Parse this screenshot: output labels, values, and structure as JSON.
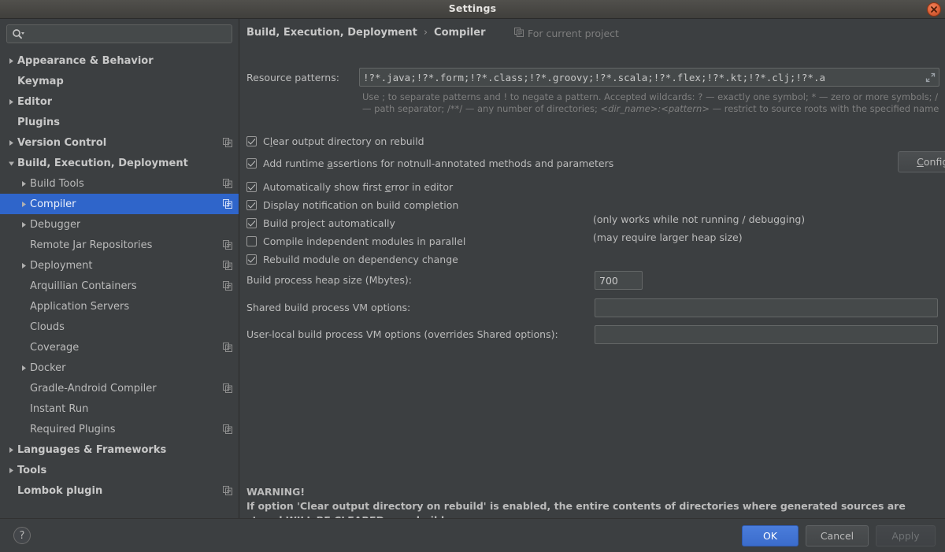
{
  "window": {
    "title": "Settings",
    "close_icon": "close-icon"
  },
  "sidebar": {
    "search": {
      "placeholder": "",
      "value": "",
      "icon": "search-icon"
    },
    "items": [
      {
        "label": "Appearance & Behavior",
        "level": 0,
        "twisty": "collapsed",
        "bold": true,
        "project_icon": false,
        "selected": false
      },
      {
        "label": "Keymap",
        "level": 0,
        "twisty": "none",
        "bold": true,
        "project_icon": false,
        "selected": false
      },
      {
        "label": "Editor",
        "level": 0,
        "twisty": "collapsed",
        "bold": true,
        "project_icon": false,
        "selected": false
      },
      {
        "label": "Plugins",
        "level": 0,
        "twisty": "none",
        "bold": true,
        "project_icon": false,
        "selected": false
      },
      {
        "label": "Version Control",
        "level": 0,
        "twisty": "collapsed",
        "bold": true,
        "project_icon": true,
        "selected": false
      },
      {
        "label": "Build, Execution, Deployment",
        "level": 0,
        "twisty": "expanded",
        "bold": true,
        "project_icon": false,
        "selected": false
      },
      {
        "label": "Build Tools",
        "level": 1,
        "twisty": "collapsed",
        "bold": false,
        "project_icon": true,
        "selected": false
      },
      {
        "label": "Compiler",
        "level": 1,
        "twisty": "collapsed",
        "bold": false,
        "project_icon": true,
        "selected": true
      },
      {
        "label": "Debugger",
        "level": 1,
        "twisty": "collapsed",
        "bold": false,
        "project_icon": false,
        "selected": false
      },
      {
        "label": "Remote Jar Repositories",
        "level": 1,
        "twisty": "none",
        "bold": false,
        "project_icon": true,
        "selected": false
      },
      {
        "label": "Deployment",
        "level": 1,
        "twisty": "collapsed",
        "bold": false,
        "project_icon": true,
        "selected": false
      },
      {
        "label": "Arquillian Containers",
        "level": 1,
        "twisty": "none",
        "bold": false,
        "project_icon": true,
        "selected": false
      },
      {
        "label": "Application Servers",
        "level": 1,
        "twisty": "none",
        "bold": false,
        "project_icon": false,
        "selected": false
      },
      {
        "label": "Clouds",
        "level": 1,
        "twisty": "none",
        "bold": false,
        "project_icon": false,
        "selected": false
      },
      {
        "label": "Coverage",
        "level": 1,
        "twisty": "none",
        "bold": false,
        "project_icon": true,
        "selected": false
      },
      {
        "label": "Docker",
        "level": 1,
        "twisty": "collapsed",
        "bold": false,
        "project_icon": false,
        "selected": false
      },
      {
        "label": "Gradle-Android Compiler",
        "level": 1,
        "twisty": "none",
        "bold": false,
        "project_icon": true,
        "selected": false
      },
      {
        "label": "Instant Run",
        "level": 1,
        "twisty": "none",
        "bold": false,
        "project_icon": false,
        "selected": false
      },
      {
        "label": "Required Plugins",
        "level": 1,
        "twisty": "none",
        "bold": false,
        "project_icon": true,
        "selected": false
      },
      {
        "label": "Languages & Frameworks",
        "level": 0,
        "twisty": "collapsed",
        "bold": true,
        "project_icon": false,
        "selected": false
      },
      {
        "label": "Tools",
        "level": 0,
        "twisty": "collapsed",
        "bold": true,
        "project_icon": false,
        "selected": false
      },
      {
        "label": "Lombok plugin",
        "level": 0,
        "twisty": "none",
        "bold": true,
        "project_icon": true,
        "selected": false
      }
    ]
  },
  "main": {
    "breadcrumb": {
      "root": "Build, Execution, Deployment",
      "separator": "›",
      "current": "Compiler"
    },
    "project_badge": {
      "label": "For current project",
      "icon": "copy-settings-icon"
    },
    "resource_patterns": {
      "label": "Resource patterns:",
      "value": "!?*.java;!?*.form;!?*.class;!?*.groovy;!?*.scala;!?*.flex;!?*.kt;!?*.clj;!?*.a",
      "expand_icon": "expand-icon"
    },
    "hint": {
      "part1": "Use ; to separate patterns and ! to negate a pattern. Accepted wildcards: ? — exactly one symbol; * — zero or more symbols; / — path separator; /**/ — any number of directories; ",
      "italic": "<dir_name>:<pattern>",
      "part2": " — restrict to source roots with the specified name"
    },
    "checkboxes": [
      {
        "label_pre": "C",
        "mnemonic": "l",
        "label_post": "ear output directory on rebuild",
        "checked": true
      },
      {
        "label_pre": "Add runtime ",
        "mnemonic": "a",
        "label_post": "ssertions for notnull-annotated methods and parameters",
        "checked": true
      },
      {
        "label_pre": "Automatically show first ",
        "mnemonic": "e",
        "label_post": "rror in editor",
        "checked": true
      },
      {
        "label_pre": "Display notification on build completion",
        "mnemonic": "",
        "label_post": "",
        "checked": true
      },
      {
        "label_pre": "Build project automatically",
        "mnemonic": "",
        "label_post": "",
        "checked": true
      },
      {
        "label_pre": "Compile independent modules in parallel",
        "mnemonic": "",
        "label_post": "",
        "checked": false
      },
      {
        "label_pre": "Rebuild module on dependency change",
        "mnemonic": "",
        "label_post": "",
        "checked": true
      }
    ],
    "notes": {
      "build_auto": "(only works while not running / debugging)",
      "parallel": "(may require larger heap size)"
    },
    "configure_annotations": {
      "pre": "C",
      "mnemonic_char": "C",
      "label": "Configure annotations..."
    },
    "heap": {
      "label": "Build process heap size (Mbytes):",
      "value": "700"
    },
    "shared_vm": {
      "label": "Shared build process VM options:",
      "value": "",
      "placeholder": ""
    },
    "userlocal_vm": {
      "label": "User-local build process VM options (overrides Shared options):",
      "value": "",
      "placeholder": ""
    },
    "warning": {
      "title": "WARNING!",
      "body": "If option 'Clear output directory on rebuild' is enabled, the entire contents of directories where generated sources are stored WILL BE CLEARED on rebuild."
    }
  },
  "footer": {
    "help_label": "?",
    "ok": "OK",
    "cancel": "Cancel",
    "apply": "Apply"
  },
  "colors": {
    "background": "#3c3f41",
    "selection": "#2f65ca",
    "accent_ok": "#3b6ccc",
    "text": "#bbbbbb",
    "hint_text": "#7f7f7f",
    "close_button": "#e0663c"
  }
}
